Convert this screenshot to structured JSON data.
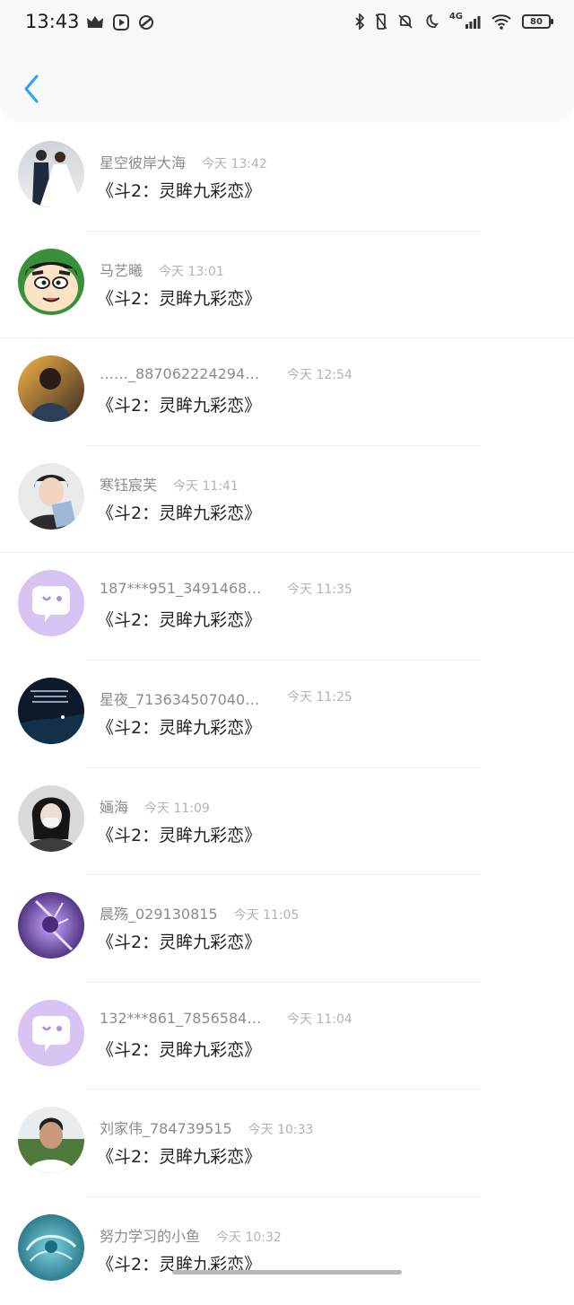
{
  "status_bar": {
    "time": "13:43",
    "network": "4G",
    "battery": "80",
    "icons": [
      "crown-icon",
      "media-icon",
      "sync-icon",
      "bluetooth-icon",
      "vibrate-off-icon",
      "mute-icon",
      "moon-icon",
      "signal-icon",
      "wifi-icon",
      "battery-icon"
    ]
  },
  "header": {
    "back_icon": "chevron-left-icon"
  },
  "accent_color": "#2fa3f2",
  "messages": [
    {
      "name": "星空彼岸大海",
      "time": "今天 13:42",
      "text": "《斗2：灵眸九彩恋》"
    },
    {
      "name": "马艺曦",
      "time": "今天 13:01",
      "text": "《斗2：灵眸九彩恋》"
    },
    {
      "name": "……_887062224294…",
      "time": "今天 12:54",
      "text": "《斗2：灵眸九彩恋》"
    },
    {
      "name": "寒钰宸芙",
      "time": "今天 11:41",
      "text": "《斗2：灵眸九彩恋》"
    },
    {
      "name": "187***951_3491468…",
      "time": "今天 11:35",
      "text": "《斗2：灵眸九彩恋》"
    },
    {
      "name": "星夜_713634507040…",
      "time": "今天 11:25",
      "text": "《斗2：灵眸九彩恋》"
    },
    {
      "name": "婳海",
      "time": "今天 11:09",
      "text": "《斗2：灵眸九彩恋》"
    },
    {
      "name": "晨殇_029130815",
      "time": "今天 11:05",
      "text": "《斗2：灵眸九彩恋》"
    },
    {
      "name": "132***861_7856584…",
      "time": "今天 11:04",
      "text": "《斗2：灵眸九彩恋》"
    },
    {
      "name": "刘家伟_784739515",
      "time": "今天 10:33",
      "text": "《斗2：灵眸九彩恋》"
    },
    {
      "name": "努力学习的小鱼",
      "time": "今天 10:32",
      "text": "《斗2：灵眸九彩恋》"
    }
  ]
}
